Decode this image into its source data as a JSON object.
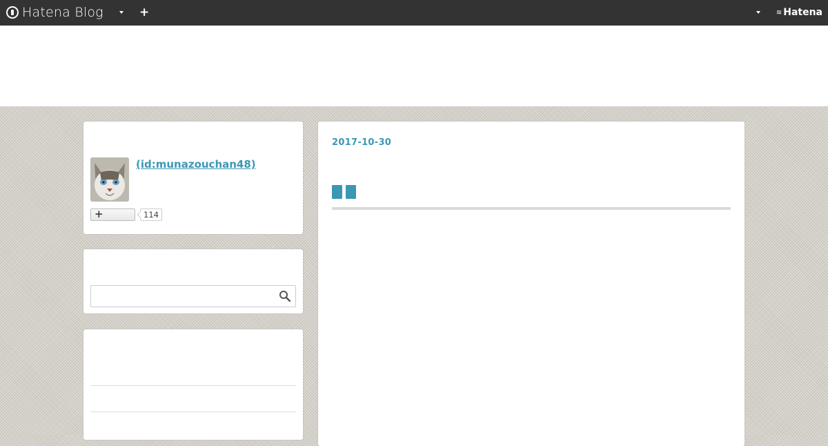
{
  "topbar": {
    "brand": "Hatena Blog",
    "add_label": "+",
    "hatena_logo": "Hatena"
  },
  "profile": {
    "id_label": " (id:munazouchan48)",
    "subscribe_count": "114",
    "subscribe_icon": "plus-icon"
  },
  "search": {
    "placeholder": "",
    "icon": "search-icon"
  },
  "entry": {
    "date": "2017-10-30",
    "title_glyphs": 2
  },
  "colors": {
    "link": "#3b97b3",
    "topbar_bg": "#333333",
    "page_bg": "#d3d0c8"
  }
}
